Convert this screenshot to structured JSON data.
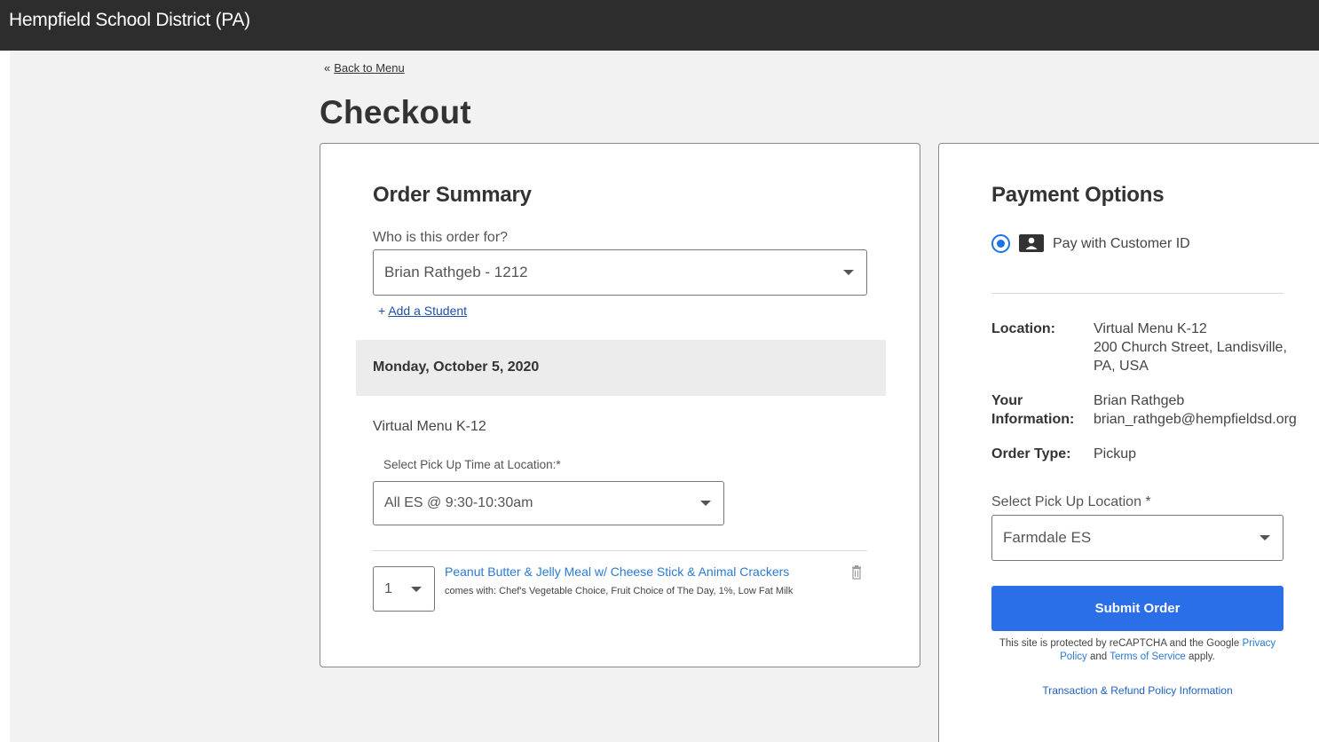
{
  "header": {
    "title": "Hempfield School District (PA)"
  },
  "nav": {
    "back_chevron": "«",
    "back_label": "Back to Menu"
  },
  "page": {
    "title": "Checkout"
  },
  "order_summary": {
    "heading": "Order Summary",
    "who_label": "Who is this order for?",
    "who_value": "Brian Rathgeb - 1212",
    "add_student_plus": "+",
    "add_student_label": "Add a Student",
    "date": "Monday, October 5, 2020",
    "menu_name": "Virtual Menu K-12",
    "pickup_time_label": "Select Pick Up Time at Location:*",
    "pickup_time_value": "All ES @ 9:30-10:30am",
    "items": [
      {
        "quantity": "1",
        "title": "Peanut Butter & Jelly Meal w/ Cheese Stick & Animal Crackers",
        "comes_with": "comes with: Chef's Vegetable Choice, Fruit Choice of The Day, 1%, Low Fat Milk",
        "delete_icon": "trash-icon"
      }
    ]
  },
  "payment": {
    "heading": "Payment Options",
    "option_label": "Pay with Customer ID",
    "option_selected": true,
    "location_key": "Location:",
    "location_name": "Virtual Menu K-12",
    "location_address_1": "200 Church Street, Landisville,",
    "location_address_2": "PA, USA",
    "info_key_1": "Your",
    "info_key_2": "Information:",
    "info_name": "Brian Rathgeb",
    "info_email": "brian_rathgeb@hempfieldsd.org",
    "order_type_key": "Order Type:",
    "order_type_value": "Pickup",
    "pickup_location_label": "Select Pick Up Location *",
    "pickup_location_value": "Farmdale ES",
    "submit_label": "Submit Order",
    "legal_prefix": "This site is protected by reCAPTCHA and the Google",
    "legal_privacy_1": "Privacy",
    "legal_privacy_2": "Policy",
    "legal_and": "and",
    "legal_terms": "Terms of Service",
    "legal_suffix": "apply.",
    "refund_link": "Transaction & Refund Policy Information"
  },
  "colors": {
    "accent": "#2a6ee8",
    "link": "#2a7ad2",
    "header_bg": "#2d2d2d",
    "page_bg": "#f2f2f2"
  }
}
